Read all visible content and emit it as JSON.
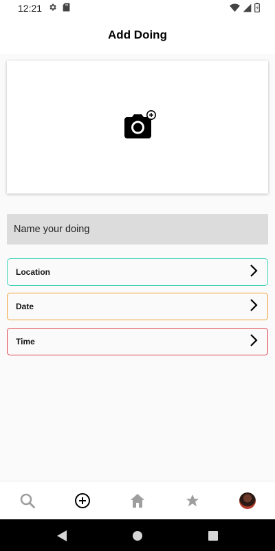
{
  "status_bar": {
    "time": "12:21",
    "left_icons": [
      "settings-icon",
      "sd-card-icon"
    ],
    "right_icons": [
      "wifi-icon",
      "signal-icon",
      "battery-icon"
    ]
  },
  "app_bar": {
    "title": "Add Doing"
  },
  "photo_picker": {
    "icon": "add-a-photo-icon"
  },
  "name_input": {
    "placeholder": "Name your doing",
    "value": ""
  },
  "options": [
    {
      "label": "Location",
      "border_color": "#3fd3b6"
    },
    {
      "label": "Date",
      "border_color": "#f0a23a"
    },
    {
      "label": "Time",
      "border_color": "#e0414f"
    }
  ],
  "bottom_nav": {
    "items": [
      "search-icon",
      "add-circle-icon",
      "home-icon",
      "star-icon",
      "avatar"
    ],
    "active": "add-circle-icon"
  },
  "system_nav": {
    "items": [
      "back-icon",
      "home-circle-icon",
      "recents-icon"
    ]
  }
}
